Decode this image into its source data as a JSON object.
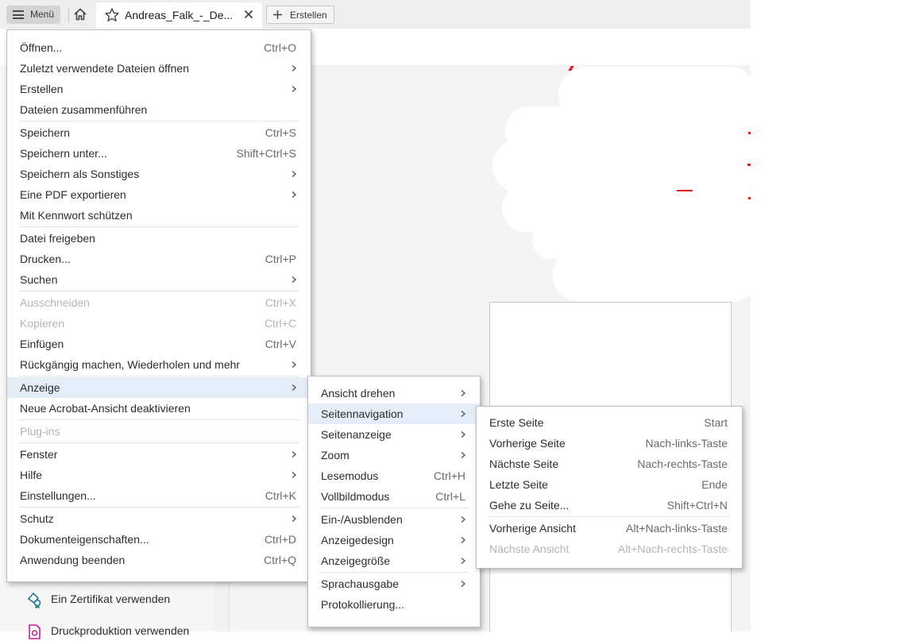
{
  "tabbar": {
    "menu_label": "Menü",
    "doc_tab_title": "Andreas_Falk_-_De...",
    "create_label": "Erstellen"
  },
  "tools": [
    {
      "label": "Ein Zertifikat verwenden",
      "icon": "certificate-icon"
    },
    {
      "label": "Druckproduktion verwenden",
      "icon": "print-production-icon"
    }
  ],
  "main_menu": [
    {
      "label": "Öffnen...",
      "shortcut": "Ctrl+O"
    },
    {
      "label": "Zuletzt verwendete Dateien öffnen",
      "submenu": true
    },
    {
      "label": "Erstellen",
      "submenu": true
    },
    {
      "label": "Dateien zusammenführen"
    },
    {
      "label": "Speichern",
      "shortcut": "Ctrl+S"
    },
    {
      "label": "Speichern unter...",
      "shortcut": "Shift+Ctrl+S"
    },
    {
      "label": "Speichern als Sonstiges",
      "submenu": true
    },
    {
      "label": "Eine PDF exportieren",
      "submenu": true
    },
    {
      "label": "Mit Kennwort schützen"
    },
    {
      "label": "Datei freigeben"
    },
    {
      "label": "Drucken...",
      "shortcut": "Ctrl+P"
    },
    {
      "label": "Suchen",
      "submenu": true
    },
    {
      "label": "Ausschneiden",
      "shortcut": "Ctrl+X",
      "disabled": true
    },
    {
      "label": "Kopieren",
      "shortcut": "Ctrl+C",
      "disabled": true
    },
    {
      "label": "Einfügen",
      "shortcut": "Ctrl+V"
    },
    {
      "label": "Rückgängig machen, Wiederholen und mehr",
      "submenu": true
    },
    {
      "label": "Anzeige",
      "submenu": true,
      "highlighted": true
    },
    {
      "label": "Neue Acrobat-Ansicht deaktivieren"
    },
    {
      "label": "Plug-ins",
      "disabled": true
    },
    {
      "label": "Fenster",
      "submenu": true
    },
    {
      "label": "Hilfe",
      "submenu": true
    },
    {
      "label": "Einstellungen...",
      "shortcut": "Ctrl+K"
    },
    {
      "label": "Schutz",
      "submenu": true
    },
    {
      "label": "Dokumenteigenschaften...",
      "shortcut": "Ctrl+D"
    },
    {
      "label": "Anwendung beenden",
      "shortcut": "Ctrl+Q"
    }
  ],
  "anzeige_menu": [
    {
      "label": "Ansicht drehen",
      "submenu": true
    },
    {
      "label": "Seitennavigation",
      "submenu": true,
      "highlighted": true
    },
    {
      "label": "Seitenanzeige",
      "submenu": true
    },
    {
      "label": "Zoom",
      "submenu": true
    },
    {
      "label": "Lesemodus",
      "shortcut": "Ctrl+H"
    },
    {
      "label": "Vollbildmodus",
      "shortcut": "Ctrl+L"
    },
    {
      "label": "Ein-/Ausblenden",
      "submenu": true
    },
    {
      "label": "Anzeigedesign",
      "submenu": true
    },
    {
      "label": "Anzeigegröße",
      "submenu": true
    },
    {
      "label": "Sprachausgabe",
      "submenu": true
    },
    {
      "label": "Protokollierung..."
    }
  ],
  "seitennavigation_menu": [
    {
      "label": "Erste Seite",
      "shortcut": "Start"
    },
    {
      "label": "Vorherige Seite",
      "shortcut": "Nach-links-Taste"
    },
    {
      "label": "Nächste Seite",
      "shortcut": "Nach-rechts-Taste"
    },
    {
      "label": "Letzte Seite",
      "shortcut": "Ende"
    },
    {
      "label": "Gehe zu Seite...",
      "shortcut": "Shift+Ctrl+N"
    },
    {
      "label": "Vorherige Ansicht",
      "shortcut": "Alt+Nach-links-Taste"
    },
    {
      "label": "Nächste Ansicht",
      "shortcut": "Alt+Nach-rechts-Taste",
      "disabled": true
    }
  ]
}
